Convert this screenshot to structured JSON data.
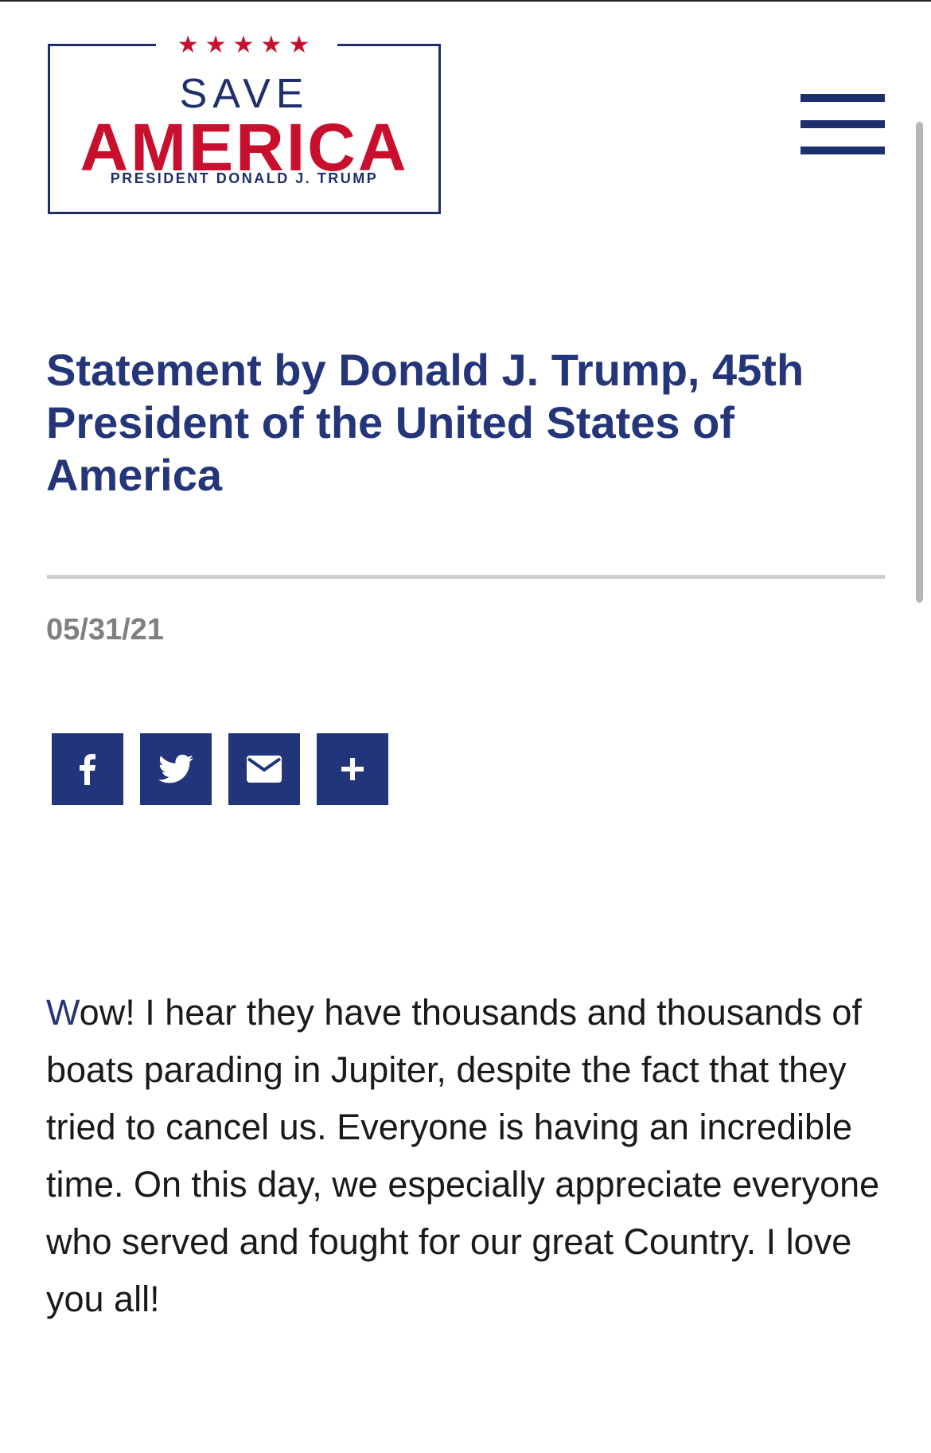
{
  "logo": {
    "stars": "★★★★★",
    "line1": "SAVE",
    "line2": "AMERICA",
    "line3": "PRESIDENT DONALD J. TRUMP"
  },
  "nav": {
    "menu_icon": "hamburger-menu-icon"
  },
  "article": {
    "title": "Statement by Donald J. Trump, 45th President of the United States of America",
    "date": "05/31/21",
    "body_first_letter": "W",
    "body_rest": "ow! I hear they have thousands and thousands of boats parading in Jupiter, despite the fact that they tried to cancel us. Everyone is having an incredible time. On this day, we especially appreciate everyone who served and fought for our great Country.  I love you all!"
  },
  "share": {
    "buttons": [
      "facebook-icon",
      "twitter-icon",
      "email-icon",
      "plus-icon"
    ]
  },
  "colors": {
    "navy": "#243679",
    "red": "#c8102e",
    "date_gray": "#808080",
    "divider": "#cfcfcf"
  }
}
